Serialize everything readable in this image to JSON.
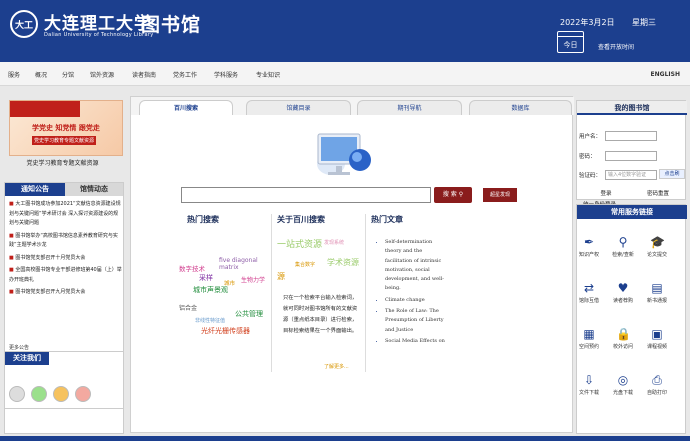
{
  "header": {
    "logo_text": "大工",
    "univ_cn": "大连理工大学",
    "univ_en": "Dalian University of Technology Library",
    "lib_cn": "图书馆",
    "date": "2022年3月2日",
    "weekday": "星期三",
    "calendar_label": "今日",
    "open_time": "查看开放时间"
  },
  "nav": {
    "items": [
      "服务",
      "概况",
      "分馆",
      "馆外资源",
      "读者指南",
      "党务工作",
      "学科服务",
      "专业知识"
    ],
    "english": "ENGLISH"
  },
  "left": {
    "banner_title": "学党史 知党情 跟党走",
    "banner_sub": "党史学习教育专题文献资源",
    "banner_caption": "党史学习教育专题文献资源",
    "tabs": [
      "通知公告",
      "馆情动态"
    ],
    "notices": [
      {
        "text": "大工图书馆成功参加2021“文献信息资源建设规划与关键问题”学术研讨会 深入探讨资源建设的规划与关键问题",
        "red": false
      },
      {
        "text": "图书馆举办“高校图书馆信息素养教育研究与实践”主题学术沙龙",
        "red": false
      },
      {
        "text": "图书馆党支部召开十月党员大会",
        "red": false
      },
      {
        "text": "全国高校图书馆专业干部进修班第40届（上）举办开班典礼",
        "red": false
      },
      {
        "text": "图书馆党支部召开九月党员大会",
        "red": false
      }
    ],
    "more": "更多公告",
    "follow_title": "关注我们"
  },
  "main": {
    "tabs": [
      "百川搜索",
      "馆藏目录",
      "期刊导航",
      "数据库"
    ],
    "search_btn": "搜 索",
    "adv_btn": "超星发现",
    "hot_search_title": "热门搜索",
    "about_title": "关于百川搜索",
    "hot_article_title": "热门文章",
    "cloud": [
      "一站式资源",
      "发现系统",
      "数字技术",
      "five diagonal matrix",
      "集合数字",
      "学术资源",
      "采样",
      "城市声景观",
      "城市",
      "生物力学",
      "铝合金",
      "公共管理",
      "非线性特征值",
      "光纤光栅传感器",
      "源"
    ],
    "intro": "只在一个检索平台输入检索词，就可同时对图书馆所有的文献资源（重点纸本目录）进行检索，目标检索结果在一个界面输出。",
    "more": "了解更多...",
    "articles": [
      "Self-determination theory and the facilitation of intrinsic motivation, social development, and well-being.",
      "Climate change",
      "The Role of Law: The Presumption of Liberty and Justice",
      "Social Media Effects on"
    ]
  },
  "right": {
    "mylib_title": "我的图书馆",
    "user_label": "用户名：",
    "pwd_label": "密码：",
    "code_label": "验证码：",
    "code_placeholder": "输入4位数字验证",
    "code_img": "点击刷",
    "login": "登录",
    "reset": "密码重置",
    "unified": "统一身份登录",
    "svc_title": "常用服务链接",
    "services": [
      {
        "label": "知识产权",
        "icon": "pen-nib-icon"
      },
      {
        "label": "检索/查新",
        "icon": "magnifier-icon"
      },
      {
        "label": "论文提交",
        "icon": "graduation-cap-icon"
      },
      {
        "label": "馆际互借",
        "icon": "exchange-icon"
      },
      {
        "label": "读者荐购",
        "icon": "heart-book-icon"
      },
      {
        "label": "新书通报",
        "icon": "newspaper-icon"
      },
      {
        "label": "空间预约",
        "icon": "calendar-icon"
      },
      {
        "label": "校外访问",
        "icon": "lock-icon"
      },
      {
        "label": "课程视频",
        "icon": "film-icon"
      },
      {
        "label": "文件下载",
        "icon": "download-icon"
      },
      {
        "label": "光盘下载",
        "icon": "disc-icon"
      },
      {
        "label": "自助打印",
        "icon": "printer-icon"
      }
    ]
  }
}
